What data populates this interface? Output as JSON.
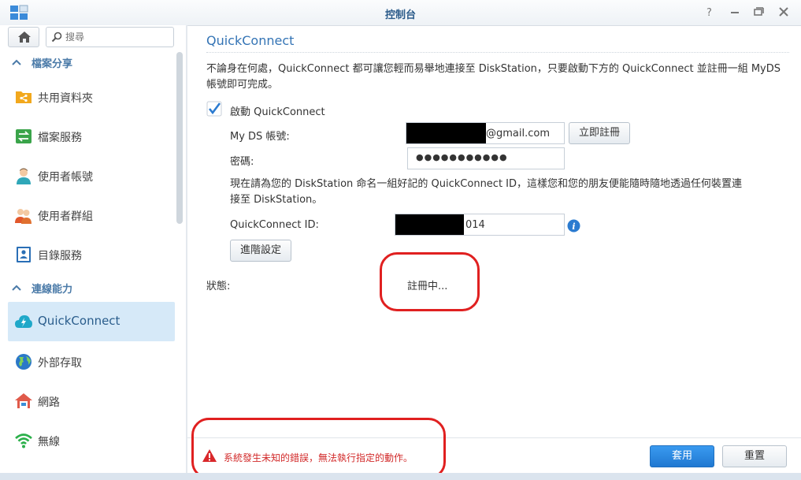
{
  "window": {
    "title": "控制台",
    "buttons": [
      "help-icon",
      "minimize-icon",
      "maximize-icon",
      "close-icon"
    ]
  },
  "sidebar": {
    "search_placeholder": "搜尋",
    "sections": [
      {
        "label": "檔案分享",
        "items": [
          {
            "label": "共用資料夾",
            "icon": "shared-folder-icon"
          },
          {
            "label": "檔案服務",
            "icon": "file-services-icon"
          },
          {
            "label": "使用者帳號",
            "icon": "user-icon"
          },
          {
            "label": "使用者群組",
            "icon": "group-icon"
          },
          {
            "label": "目錄服務",
            "icon": "directory-icon"
          }
        ]
      },
      {
        "label": "連線能力",
        "items": [
          {
            "label": "QuickConnect",
            "icon": "quickconnect-icon",
            "active": true
          },
          {
            "label": "外部存取",
            "icon": "globe-icon"
          },
          {
            "label": "網路",
            "icon": "network-house-icon"
          },
          {
            "label": "無線",
            "icon": "wifi-icon"
          }
        ]
      }
    ]
  },
  "main": {
    "title": "QuickConnect",
    "description": "不論身在何處，QuickConnect 都可讓您輕而易舉地連接至 DiskStation，只要啟動下方的 QuickConnect 並註冊一組 MyDS 帳號即可完成。",
    "enable_label": "啟動 QuickConnect",
    "enable_checked": true,
    "myds_label": "My DS 帳號:",
    "myds_value_suffix": "@gmail.com",
    "register_button": "立即註冊",
    "password_label": "密碼:",
    "password_value": "●●●●●●●●●●●",
    "name_instruction": "現在請為您的 DiskStation 命名一組好記的 QuickConnect ID，這樣您和您的朋友便能隨時隨地透過任何裝置連接至 DiskStation。",
    "qcid_label": "QuickConnect ID:",
    "qcid_value_suffix": "014",
    "advanced_button": "進階設定",
    "status_label": "狀態:",
    "status_value": "註冊中..."
  },
  "footer": {
    "error_message": "系統發生未知的錯誤，無法執行指定的動作。",
    "apply_button": "套用",
    "reset_button": "重置"
  },
  "colors": {
    "accent": "#3474b5",
    "active_bg": "#d6e9f8",
    "error": "#d22a2a",
    "annotation": "#e02020",
    "apply_bg": "#2684de"
  }
}
